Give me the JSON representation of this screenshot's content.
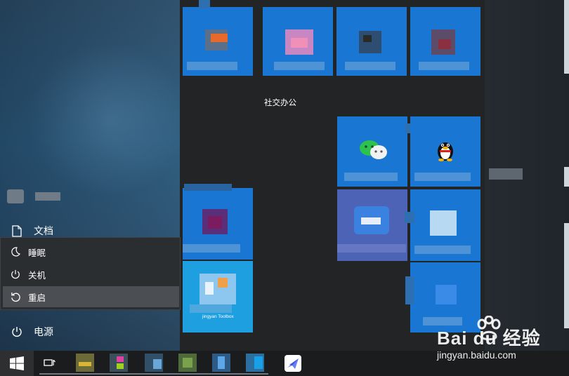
{
  "start_menu": {
    "rail": {
      "documents_label": "文档",
      "power_label": "电源"
    },
    "power_flyout": {
      "items": [
        {
          "label": "睡眠",
          "icon": "moon-icon"
        },
        {
          "label": "关机",
          "icon": "power-icon"
        },
        {
          "label": "重启",
          "icon": "restart-icon"
        }
      ],
      "selected": "重启"
    },
    "tiles": {
      "group_label": "社交办公",
      "jingyan_tile_text": "jingyan Toolbox"
    }
  },
  "taskbar": {
    "start_icon": "windows-logo-icon",
    "task_view_icon": "task-view-icon"
  },
  "watermark": {
    "text": "Bai du 经验",
    "url": "jingyan.baidu.com"
  },
  "colors": {
    "tile_blue": "#1976d2",
    "rail_blue": "#2a5a7c",
    "flyout_bg": "#2b2e31",
    "taskbar_bg": "#1b1c1e"
  }
}
